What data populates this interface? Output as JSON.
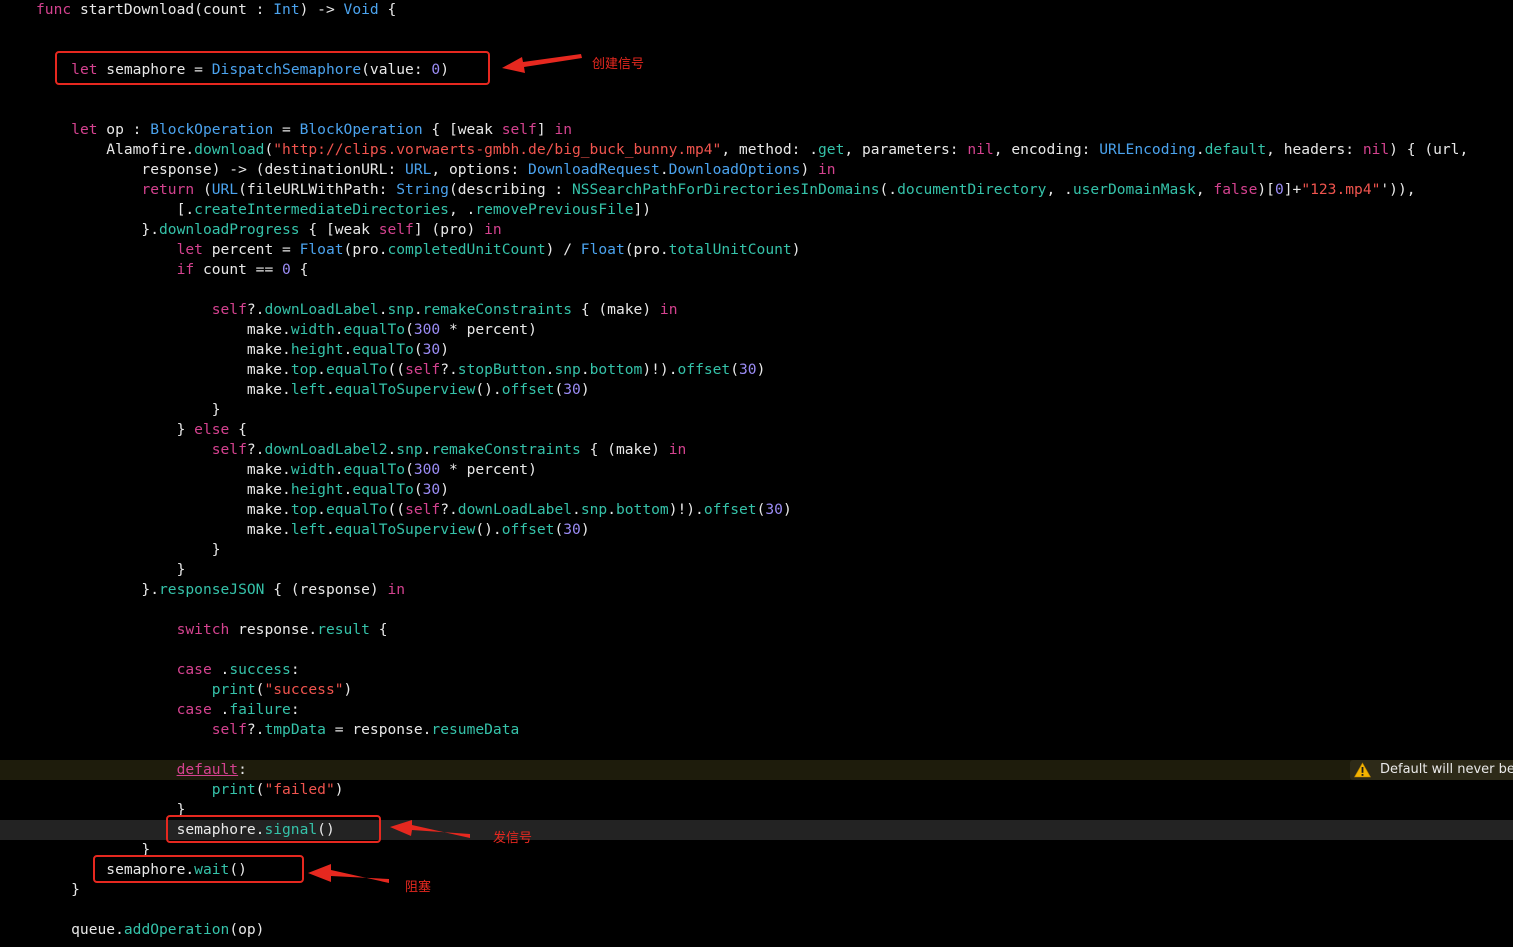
{
  "editor": {
    "lines": [
      {
        "tokens": [
          [
            "kw",
            "func"
          ],
          [
            "plain",
            " startDownload(count : "
          ],
          [
            "type",
            "Int"
          ],
          [
            "plain",
            ") -> "
          ],
          [
            "type",
            "Void"
          ],
          [
            "plain",
            " {"
          ]
        ]
      },
      {
        "tokens": []
      },
      {
        "tokens": []
      },
      {
        "tokens": [
          [
            "plain",
            "    "
          ],
          [
            "kw",
            "let"
          ],
          [
            "plain",
            " semaphore = "
          ],
          [
            "type",
            "DispatchSemaphore"
          ],
          [
            "plain",
            "(value: "
          ],
          [
            "num",
            "0"
          ],
          [
            "plain",
            ")"
          ]
        ]
      },
      {
        "tokens": []
      },
      {
        "tokens": []
      },
      {
        "tokens": [
          [
            "plain",
            "    "
          ],
          [
            "kw",
            "let"
          ],
          [
            "plain",
            " op : "
          ],
          [
            "type",
            "BlockOperation"
          ],
          [
            "plain",
            " = "
          ],
          [
            "type",
            "BlockOperation"
          ],
          [
            "plain",
            " { [weak "
          ],
          [
            "kw",
            "self"
          ],
          [
            "plain",
            "] "
          ],
          [
            "kw",
            "in"
          ]
        ]
      },
      {
        "tokens": [
          [
            "plain",
            "        Alamofire."
          ],
          [
            "method",
            "download"
          ],
          [
            "plain",
            "("
          ],
          [
            "str",
            "\"http://clips.vorwaerts-gmbh.de/big_buck_bunny.mp4\""
          ],
          [
            "plain",
            ", method: ."
          ],
          [
            "prop",
            "get"
          ],
          [
            "plain",
            ", parameters: "
          ],
          [
            "kw",
            "nil"
          ],
          [
            "plain",
            ", encoding: "
          ],
          [
            "type",
            "URLEncoding"
          ],
          [
            "plain",
            "."
          ],
          [
            "prop",
            "default"
          ],
          [
            "plain",
            ", headers: "
          ],
          [
            "kw",
            "nil"
          ],
          [
            "plain",
            ") { (url,"
          ]
        ]
      },
      {
        "tokens": [
          [
            "plain",
            "            response) -> (destinationURL: "
          ],
          [
            "type",
            "URL"
          ],
          [
            "plain",
            ", options: "
          ],
          [
            "type",
            "DownloadRequest"
          ],
          [
            "plain",
            "."
          ],
          [
            "type",
            "DownloadOptions"
          ],
          [
            "plain",
            ") "
          ],
          [
            "kw",
            "in"
          ]
        ]
      },
      {
        "tokens": [
          [
            "plain",
            "            "
          ],
          [
            "kw",
            "return"
          ],
          [
            "plain",
            " ("
          ],
          [
            "type",
            "URL"
          ],
          [
            "plain",
            "(fileURLWithPath: "
          ],
          [
            "type",
            "String"
          ],
          [
            "plain",
            "(describing : "
          ],
          [
            "method",
            "NSSearchPathForDirectoriesInDomains"
          ],
          [
            "plain",
            "(."
          ],
          [
            "prop",
            "documentDirectory"
          ],
          [
            "plain",
            ", ."
          ],
          [
            "prop",
            "userDomainMask"
          ],
          [
            "plain",
            ", "
          ],
          [
            "kw",
            "false"
          ],
          [
            "plain",
            ")["
          ],
          [
            "num",
            "0"
          ],
          [
            "plain",
            "]+"
          ],
          [
            "str",
            "\"123.mp4\""
          ],
          [
            "plain",
            "')),"
          ]
        ]
      },
      {
        "tokens": [
          [
            "plain",
            "                [."
          ],
          [
            "prop",
            "createIntermediateDirectories"
          ],
          [
            "plain",
            ", ."
          ],
          [
            "prop",
            "removePreviousFile"
          ],
          [
            "plain",
            "])"
          ]
        ]
      },
      {
        "tokens": [
          [
            "plain",
            "            }."
          ],
          [
            "method",
            "downloadProgress"
          ],
          [
            "plain",
            " { [weak "
          ],
          [
            "kw",
            "self"
          ],
          [
            "plain",
            "] (pro) "
          ],
          [
            "kw",
            "in"
          ]
        ]
      },
      {
        "tokens": [
          [
            "plain",
            "                "
          ],
          [
            "kw",
            "let"
          ],
          [
            "plain",
            " percent = "
          ],
          [
            "type",
            "Float"
          ],
          [
            "plain",
            "(pro."
          ],
          [
            "prop",
            "completedUnitCount"
          ],
          [
            "plain",
            ") / "
          ],
          [
            "type",
            "Float"
          ],
          [
            "plain",
            "(pro."
          ],
          [
            "prop",
            "totalUnitCount"
          ],
          [
            "plain",
            ")"
          ]
        ]
      },
      {
        "tokens": [
          [
            "plain",
            "                "
          ],
          [
            "kw",
            "if"
          ],
          [
            "plain",
            " count == "
          ],
          [
            "num",
            "0"
          ],
          [
            "plain",
            " {"
          ]
        ]
      },
      {
        "tokens": []
      },
      {
        "tokens": [
          [
            "plain",
            "                    "
          ],
          [
            "kw",
            "self"
          ],
          [
            "plain",
            "?."
          ],
          [
            "prop",
            "downLoadLabel"
          ],
          [
            "plain",
            "."
          ],
          [
            "prop",
            "snp"
          ],
          [
            "plain",
            "."
          ],
          [
            "method",
            "remakeConstraints"
          ],
          [
            "plain",
            " { (make) "
          ],
          [
            "kw",
            "in"
          ]
        ]
      },
      {
        "tokens": [
          [
            "plain",
            "                        make."
          ],
          [
            "prop",
            "width"
          ],
          [
            "plain",
            "."
          ],
          [
            "method",
            "equalTo"
          ],
          [
            "plain",
            "("
          ],
          [
            "num",
            "300"
          ],
          [
            "plain",
            " * percent)"
          ]
        ]
      },
      {
        "tokens": [
          [
            "plain",
            "                        make."
          ],
          [
            "prop",
            "height"
          ],
          [
            "plain",
            "."
          ],
          [
            "method",
            "equalTo"
          ],
          [
            "plain",
            "("
          ],
          [
            "num",
            "30"
          ],
          [
            "plain",
            ")"
          ]
        ]
      },
      {
        "tokens": [
          [
            "plain",
            "                        make."
          ],
          [
            "prop",
            "top"
          ],
          [
            "plain",
            "."
          ],
          [
            "method",
            "equalTo"
          ],
          [
            "plain",
            "(("
          ],
          [
            "kw",
            "self"
          ],
          [
            "plain",
            "?."
          ],
          [
            "prop",
            "stopButton"
          ],
          [
            "plain",
            "."
          ],
          [
            "prop",
            "snp"
          ],
          [
            "plain",
            "."
          ],
          [
            "prop",
            "bottom"
          ],
          [
            "plain",
            ")!)."
          ],
          [
            "method",
            "offset"
          ],
          [
            "plain",
            "("
          ],
          [
            "num",
            "30"
          ],
          [
            "plain",
            ")"
          ]
        ]
      },
      {
        "tokens": [
          [
            "plain",
            "                        make."
          ],
          [
            "prop",
            "left"
          ],
          [
            "plain",
            "."
          ],
          [
            "method",
            "equalToSuperview"
          ],
          [
            "plain",
            "()."
          ],
          [
            "method",
            "offset"
          ],
          [
            "plain",
            "("
          ],
          [
            "num",
            "30"
          ],
          [
            "plain",
            ")"
          ]
        ]
      },
      {
        "tokens": [
          [
            "plain",
            "                    }"
          ]
        ]
      },
      {
        "tokens": [
          [
            "plain",
            "                } "
          ],
          [
            "kw",
            "else"
          ],
          [
            "plain",
            " {"
          ]
        ]
      },
      {
        "tokens": [
          [
            "plain",
            "                    "
          ],
          [
            "kw",
            "self"
          ],
          [
            "plain",
            "?."
          ],
          [
            "prop",
            "downLoadLabel2"
          ],
          [
            "plain",
            "."
          ],
          [
            "prop",
            "snp"
          ],
          [
            "plain",
            "."
          ],
          [
            "method",
            "remakeConstraints"
          ],
          [
            "plain",
            " { (make) "
          ],
          [
            "kw",
            "in"
          ]
        ]
      },
      {
        "tokens": [
          [
            "plain",
            "                        make."
          ],
          [
            "prop",
            "width"
          ],
          [
            "plain",
            "."
          ],
          [
            "method",
            "equalTo"
          ],
          [
            "plain",
            "("
          ],
          [
            "num",
            "300"
          ],
          [
            "plain",
            " * percent)"
          ]
        ]
      },
      {
        "tokens": [
          [
            "plain",
            "                        make."
          ],
          [
            "prop",
            "height"
          ],
          [
            "plain",
            "."
          ],
          [
            "method",
            "equalTo"
          ],
          [
            "plain",
            "("
          ],
          [
            "num",
            "30"
          ],
          [
            "plain",
            ")"
          ]
        ]
      },
      {
        "tokens": [
          [
            "plain",
            "                        make."
          ],
          [
            "prop",
            "top"
          ],
          [
            "plain",
            "."
          ],
          [
            "method",
            "equalTo"
          ],
          [
            "plain",
            "(("
          ],
          [
            "kw",
            "self"
          ],
          [
            "plain",
            "?."
          ],
          [
            "prop",
            "downLoadLabel"
          ],
          [
            "plain",
            "."
          ],
          [
            "prop",
            "snp"
          ],
          [
            "plain",
            "."
          ],
          [
            "prop",
            "bottom"
          ],
          [
            "plain",
            ")!)."
          ],
          [
            "method",
            "offset"
          ],
          [
            "plain",
            "("
          ],
          [
            "num",
            "30"
          ],
          [
            "plain",
            ")"
          ]
        ]
      },
      {
        "tokens": [
          [
            "plain",
            "                        make."
          ],
          [
            "prop",
            "left"
          ],
          [
            "plain",
            "."
          ],
          [
            "method",
            "equalToSuperview"
          ],
          [
            "plain",
            "()."
          ],
          [
            "method",
            "offset"
          ],
          [
            "plain",
            "("
          ],
          [
            "num",
            "30"
          ],
          [
            "plain",
            ")"
          ]
        ]
      },
      {
        "tokens": [
          [
            "plain",
            "                    }"
          ]
        ]
      },
      {
        "tokens": [
          [
            "plain",
            "                }"
          ]
        ]
      },
      {
        "tokens": [
          [
            "plain",
            "            }."
          ],
          [
            "method",
            "responseJSON"
          ],
          [
            "plain",
            " { (response) "
          ],
          [
            "kw",
            "in"
          ]
        ]
      },
      {
        "tokens": []
      },
      {
        "tokens": [
          [
            "plain",
            "                "
          ],
          [
            "kw",
            "switch"
          ],
          [
            "plain",
            " response."
          ],
          [
            "prop",
            "result"
          ],
          [
            "plain",
            " {"
          ]
        ]
      },
      {
        "tokens": []
      },
      {
        "tokens": [
          [
            "plain",
            "                "
          ],
          [
            "kw",
            "case"
          ],
          [
            "plain",
            " ."
          ],
          [
            "prop",
            "success"
          ],
          [
            "plain",
            ":"
          ]
        ]
      },
      {
        "tokens": [
          [
            "plain",
            "                    "
          ],
          [
            "method",
            "print"
          ],
          [
            "plain",
            "("
          ],
          [
            "str",
            "\"success\""
          ],
          [
            "plain",
            ")"
          ]
        ]
      },
      {
        "tokens": [
          [
            "plain",
            "                "
          ],
          [
            "kw",
            "case"
          ],
          [
            "plain",
            " ."
          ],
          [
            "prop",
            "failure"
          ],
          [
            "plain",
            ":"
          ]
        ]
      },
      {
        "tokens": [
          [
            "plain",
            "                    "
          ],
          [
            "kw",
            "self"
          ],
          [
            "plain",
            "?."
          ],
          [
            "prop",
            "tmpData"
          ],
          [
            "plain",
            " = response."
          ],
          [
            "prop",
            "resumeData"
          ]
        ]
      },
      {
        "tokens": []
      },
      {
        "tokens": [
          [
            "plain",
            "                "
          ],
          [
            "default",
            "default"
          ],
          [
            "plain",
            ":"
          ]
        ]
      },
      {
        "tokens": [
          [
            "plain",
            "                    "
          ],
          [
            "method",
            "print"
          ],
          [
            "plain",
            "("
          ],
          [
            "str",
            "\"failed\""
          ],
          [
            "plain",
            ")"
          ]
        ]
      },
      {
        "tokens": [
          [
            "plain",
            "                }"
          ]
        ]
      },
      {
        "tokens": [
          [
            "plain",
            "                semaphore."
          ],
          [
            "method",
            "signal"
          ],
          [
            "plain",
            "()"
          ]
        ]
      },
      {
        "tokens": [
          [
            "plain",
            "            }"
          ]
        ]
      },
      {
        "tokens": [
          [
            "plain",
            "        semaphore."
          ],
          [
            "method",
            "wait"
          ],
          [
            "plain",
            "()"
          ]
        ]
      },
      {
        "tokens": [
          [
            "plain",
            "    }"
          ]
        ]
      },
      {
        "tokens": []
      },
      {
        "tokens": [
          [
            "plain",
            "    queue."
          ],
          [
            "method",
            "addOperation"
          ],
          [
            "plain",
            "(op)"
          ]
        ]
      }
    ],
    "warning_line_index": 38,
    "current_line_index": 41
  },
  "warning": {
    "icon": "warning-triangle-icon",
    "text": "Default will never be executed"
  },
  "annotations": {
    "create_label": "创建信号",
    "signal_label": "发信号",
    "wait_label": "阻塞",
    "color": "#e6281f"
  },
  "colors": {
    "background": "#000000",
    "plain": "#e8e8e8",
    "keyword": "#d4428f",
    "type": "#4ba3ee",
    "method": "#35c2a9",
    "number": "#9b8cf5",
    "string": "#f0544e"
  }
}
